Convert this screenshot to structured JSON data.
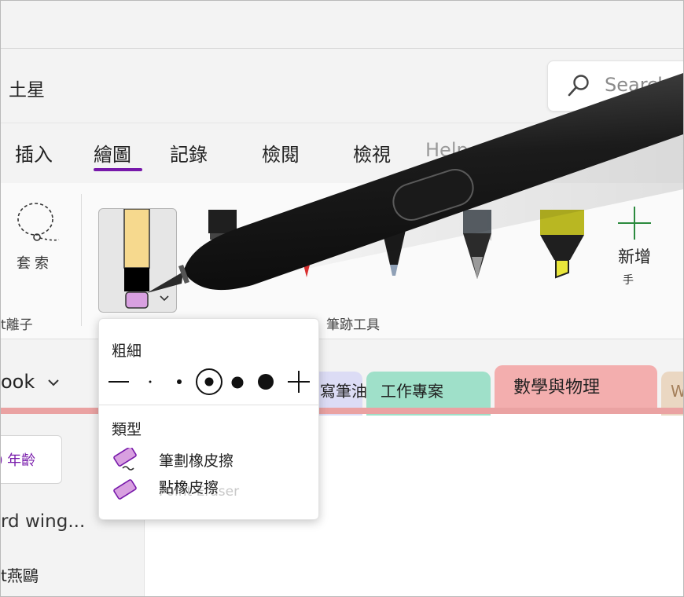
{
  "app": {
    "title": "土星"
  },
  "search": {
    "placeholder": "Search"
  },
  "tabs": [
    {
      "label": "插入"
    },
    {
      "label": "繪圖",
      "active": true
    },
    {
      "label": "記錄"
    },
    {
      "label": "檢閱"
    },
    {
      "label": "檢視"
    },
    {
      "label": "Help"
    }
  ],
  "ribbon": {
    "lasso_label": "套索",
    "lasso_group_label": "t離子",
    "pen_group_label": "筆跡工具",
    "add_label": "新增",
    "add_sub": "手",
    "selected_pen_color": "#d8a0e0",
    "highlighter_color": "#b9b722"
  },
  "notebook": {
    "label": "ook",
    "sections": [
      {
        "label": "寫筆油",
        "color": "#dcdcf5"
      },
      {
        "label": "工作專案",
        "color": "#9fe0c9"
      },
      {
        "label": "數學與物理",
        "color": "#f3aeae"
      },
      {
        "label": "W",
        "color": "#ead7c2"
      }
    ]
  },
  "sidebar": {
    "tag": "0 年齡",
    "pages": [
      {
        "label": "rd wing..."
      },
      {
        "label": "t燕鷗"
      }
    ]
  },
  "popup": {
    "thickness_label": "粗細",
    "type_label": "類型",
    "stroke_eraser": "筆劃橡皮擦",
    "point_eraser": "點橡皮擦",
    "point_eraser_en": "Point Eraser"
  }
}
